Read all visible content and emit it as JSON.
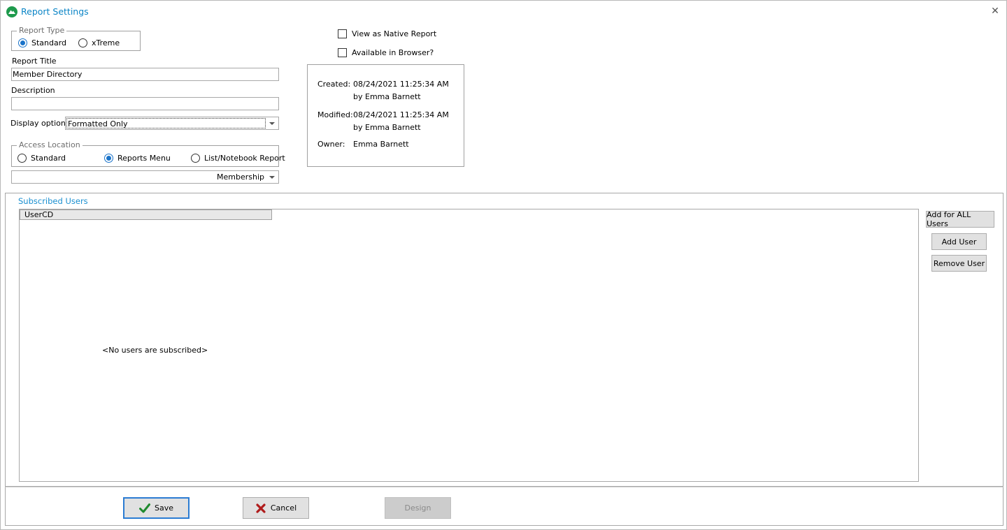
{
  "window": {
    "title": "Report Settings",
    "close_glyph": "✕"
  },
  "report_type": {
    "legend": "Report Type",
    "options": [
      {
        "label": "Standard",
        "selected": true
      },
      {
        "label": "xTreme",
        "selected": false
      }
    ]
  },
  "native_report": {
    "label": "View as Native Report",
    "checked": false
  },
  "browser": {
    "label": "Available in Browser?",
    "checked": false
  },
  "report_title": {
    "label": "Report Title",
    "value": "Member Directory"
  },
  "description": {
    "label": "Description",
    "value": ""
  },
  "display_option": {
    "label": "Display option",
    "value": "Formatted Only"
  },
  "access_location": {
    "legend": "Access Location",
    "options": [
      {
        "label": "Standard",
        "selected": false
      },
      {
        "label": "Reports Menu",
        "selected": true
      },
      {
        "label": "List/Notebook Report",
        "selected": false
      }
    ],
    "menu_value": "Membership"
  },
  "info": {
    "created_label": "Created:",
    "created_value": "08/24/2021 11:25:34 AM",
    "created_by_label": "by",
    "created_by": "Emma Barnett",
    "modified_label": "Modified:",
    "modified_value": "08/24/2021 11:25:34 AM",
    "modified_by_label": "by",
    "modified_by": "Emma Barnett",
    "owner_label": "Owner:",
    "owner_value": "Emma Barnett"
  },
  "subscribed": {
    "title": "Subscribed Users",
    "columns": [
      "UserCD"
    ],
    "empty_message": "<No users are subscribed>",
    "buttons": {
      "add_all": "Add for ALL Users",
      "add_user": "Add User",
      "remove_user": "Remove User"
    }
  },
  "footer": {
    "save": "Save",
    "cancel": "Cancel",
    "design": "Design"
  },
  "colors": {
    "accent": "#1a73c9",
    "title": "#0a84c6",
    "save_icon": "#1f8a2e",
    "cancel_icon": "#b01c1c"
  },
  "icons": {
    "app": "app-logo-icon",
    "close": "close-icon",
    "save": "checkmark-icon",
    "cancel": "x-icon",
    "dropdown": "chevron-down-icon"
  }
}
